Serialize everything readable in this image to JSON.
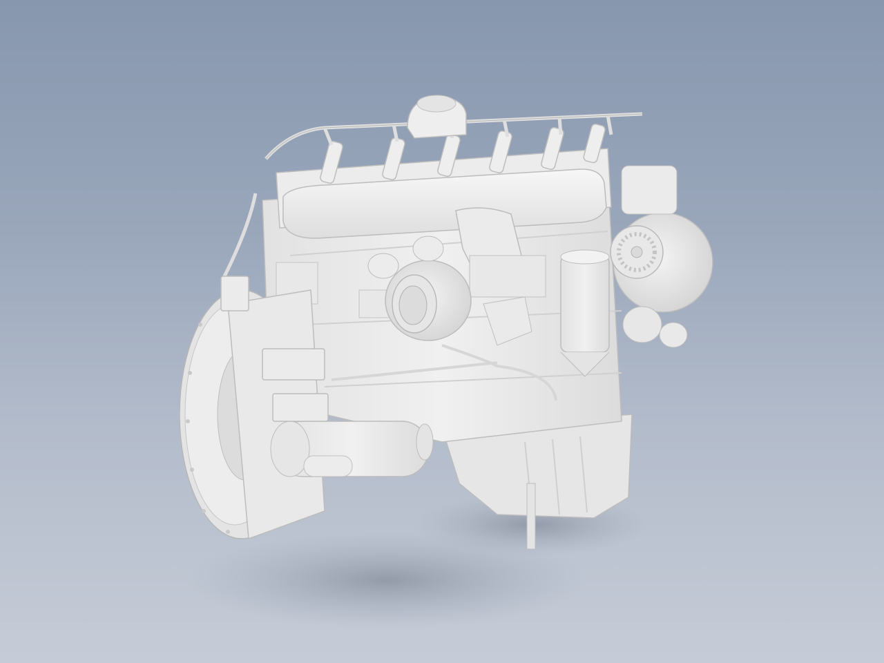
{
  "viewport": {
    "background_top": "#8797ae",
    "background_bottom": "#c6ccd7",
    "model_color": "#eeeeee",
    "model_edge_color": "#b9b9b9",
    "shadow_color": "#8e96a6"
  },
  "model": {
    "icon": "diesel-engine-3d-model",
    "render_style": "shaded gray, no text labels"
  }
}
